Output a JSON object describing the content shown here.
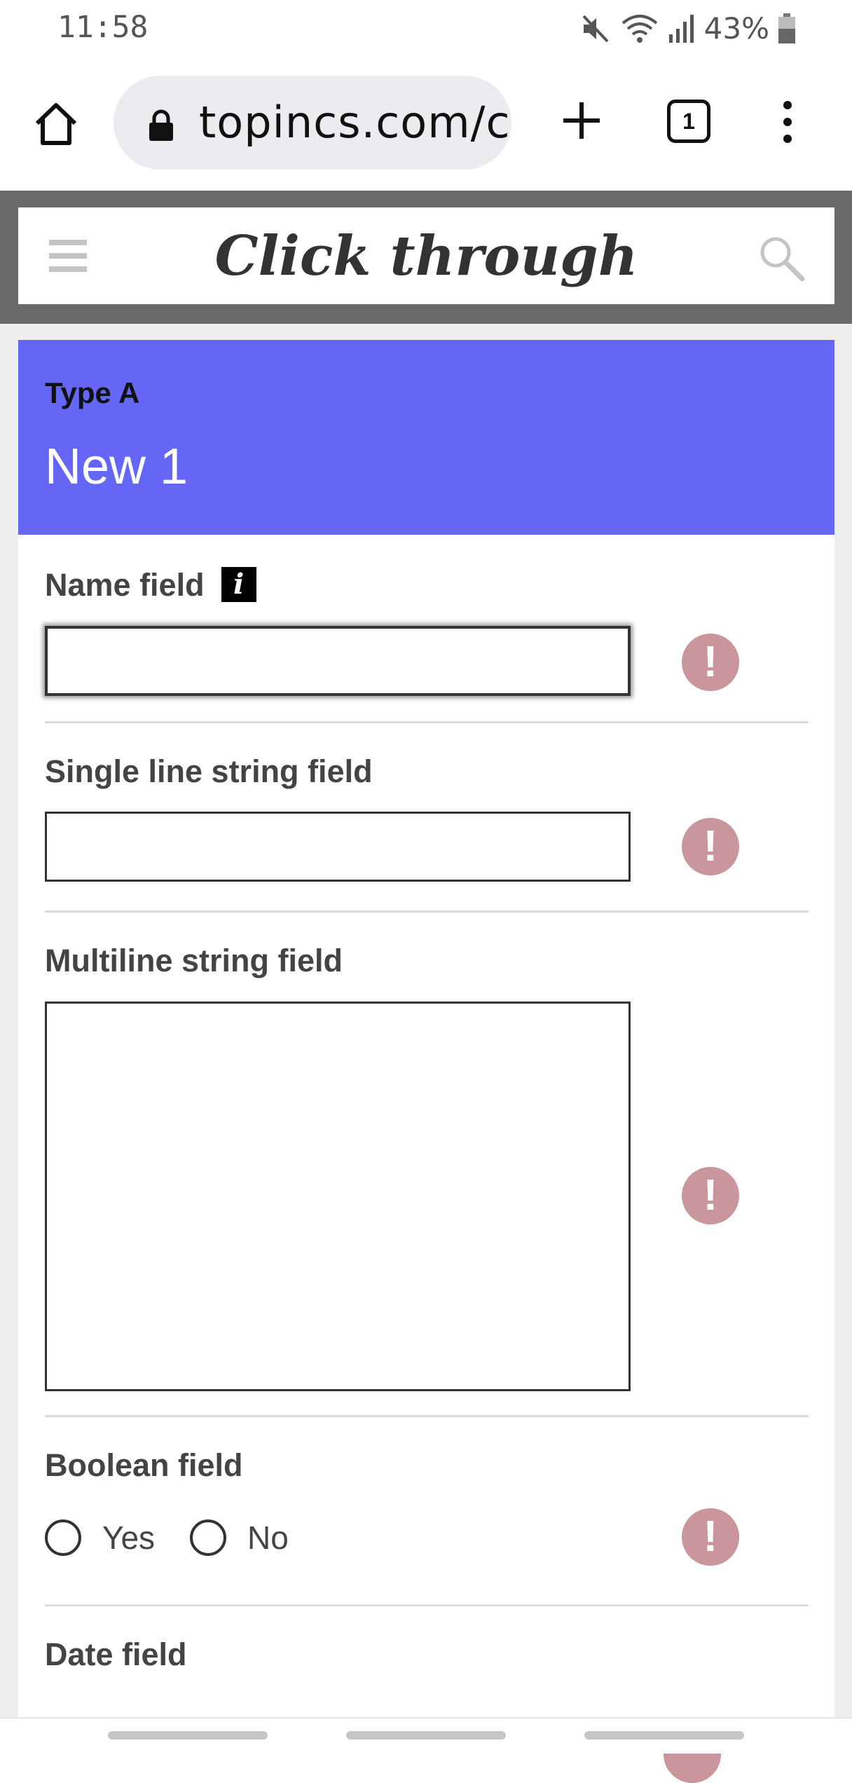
{
  "status_bar": {
    "time": "11:58",
    "icons": [
      "mute-icon",
      "wifi-icon",
      "signal-icon",
      "battery-icon"
    ],
    "battery": "43%"
  },
  "browser": {
    "url": "topincs.com/c",
    "tab_count": "1",
    "icons": [
      "home-icon",
      "lock-icon",
      "plus-icon",
      "tabs-icon",
      "more-vert-icon"
    ]
  },
  "app": {
    "title": "Click through",
    "icons": [
      "menu-icon",
      "search-icon"
    ]
  },
  "card": {
    "type": "Type A",
    "title": "New 1",
    "header_color": "#6666f6"
  },
  "fields": {
    "name": {
      "label": "Name field",
      "info": "i",
      "value": ""
    },
    "single_line": {
      "label": "Single line string field",
      "value": ""
    },
    "multiline": {
      "label": "Multiline string field",
      "value": ""
    },
    "boolean": {
      "label": "Boolean field",
      "options": [
        "Yes",
        "No"
      ],
      "selected": null
    },
    "date": {
      "label": "Date field"
    }
  },
  "warning_symbol": "!",
  "colors": {
    "warning": "#c8969b",
    "header_frame": "#6a6a6a"
  }
}
